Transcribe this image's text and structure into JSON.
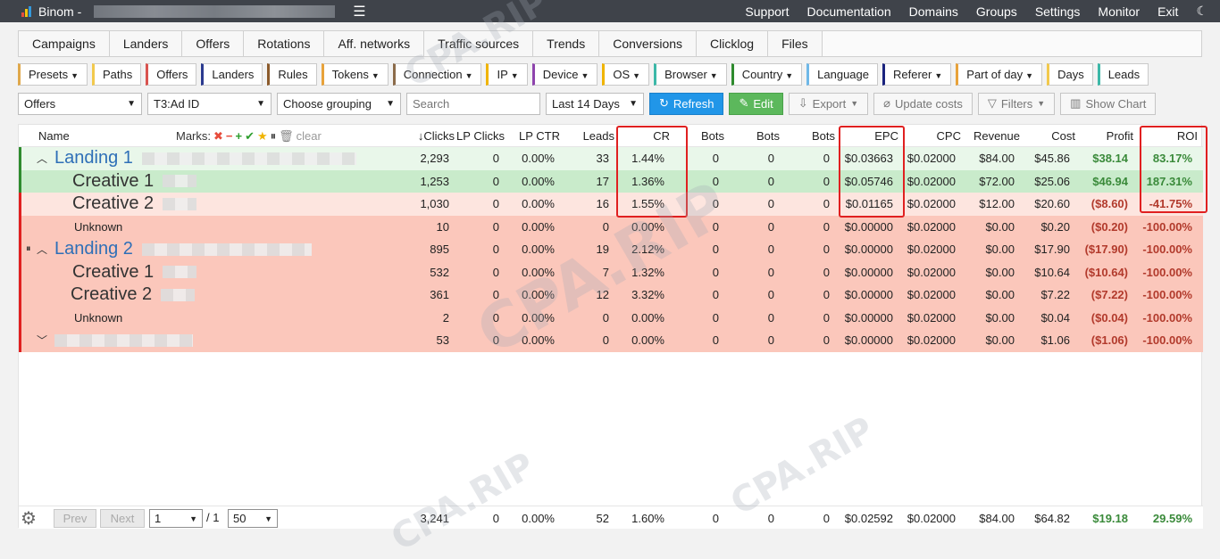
{
  "app": {
    "title": "Binom -",
    "nav": [
      "Support",
      "Documentation",
      "Domains",
      "Groups",
      "Settings",
      "Monitor",
      "Exit"
    ]
  },
  "tabs": [
    "Campaigns",
    "Landers",
    "Offers",
    "Rotations",
    "Aff. networks",
    "Traffic sources",
    "Trends",
    "Conversions",
    "Clicklog",
    "Files"
  ],
  "chips": [
    {
      "label": "Presets",
      "caret": true,
      "color": "#e0a84a"
    },
    {
      "label": "Paths",
      "caret": false,
      "color": "#f2c94c"
    },
    {
      "label": "Offers",
      "caret": false,
      "color": "#d9534f"
    },
    {
      "label": "Landers",
      "caret": false,
      "color": "#2b3a8f"
    },
    {
      "label": "Rules",
      "caret": false,
      "color": "#8b5a2b"
    },
    {
      "label": "Tokens",
      "caret": true,
      "color": "#e8a23a"
    },
    {
      "label": "Connection",
      "caret": true,
      "color": "#8b6b4a"
    },
    {
      "label": "IP",
      "caret": true,
      "color": "#f0b400"
    },
    {
      "label": "Device",
      "caret": true,
      "color": "#8e44ad"
    },
    {
      "label": "OS",
      "caret": true,
      "color": "#f0b400"
    },
    {
      "label": "Browser",
      "caret": true,
      "color": "#3cb8a8"
    },
    {
      "label": "Country",
      "caret": true,
      "color": "#2e8b2e"
    },
    {
      "label": "Language",
      "caret": false,
      "color": "#6fb8e8"
    },
    {
      "label": "Referer",
      "caret": true,
      "color": "#1a237e"
    },
    {
      "label": "Part of day",
      "caret": true,
      "color": "#e8a23a"
    },
    {
      "label": "Days",
      "caret": false,
      "color": "#f2c94c"
    },
    {
      "label": "Leads",
      "caret": false,
      "color": "#3cb8a8"
    }
  ],
  "toolbar": {
    "group1": "Offers",
    "group2": "T3:Ad ID",
    "group3": "Choose grouping",
    "search_placeholder": "Search",
    "period": "Last 14 Days",
    "refresh": "Refresh",
    "edit": "Edit",
    "export": "Export",
    "update_costs": "Update costs",
    "filters": "Filters",
    "show_chart": "Show Chart"
  },
  "columns": {
    "name": "Name",
    "marks": "Marks:",
    "clear": "clear",
    "clicks": "Clicks",
    "lp_clicks": "LP Clicks",
    "lp_ctr": "LP CTR",
    "leads": "Leads",
    "cr": "CR",
    "bots1": "Bots",
    "bots2": "Bots",
    "bots3": "Bots",
    "epc": "EPC",
    "cpc": "CPC",
    "revenue": "Revenue",
    "cost": "Cost",
    "profit": "Profit",
    "roi": "ROI"
  },
  "rows": [
    {
      "name": "Landing 1",
      "clicks": "2,293",
      "lp_clicks": "0",
      "lp_ctr": "0.00%",
      "leads": "33",
      "cr": "1.44%",
      "b1": "0",
      "b2": "0",
      "b3": "0",
      "epc": "$0.03663",
      "cpc": "$0.02000",
      "revenue": "$84.00",
      "cost": "$45.86",
      "profit": "$38.14",
      "roi": "83.17%"
    },
    {
      "name": "Creative 1",
      "clicks": "1,253",
      "lp_clicks": "0",
      "lp_ctr": "0.00%",
      "leads": "17",
      "cr": "1.36%",
      "b1": "0",
      "b2": "0",
      "b3": "0",
      "epc": "$0.05746",
      "cpc": "$0.02000",
      "revenue": "$72.00",
      "cost": "$25.06",
      "profit": "$46.94",
      "roi": "187.31%"
    },
    {
      "name": "Creative 2",
      "clicks": "1,030",
      "lp_clicks": "0",
      "lp_ctr": "0.00%",
      "leads": "16",
      "cr": "1.55%",
      "b1": "0",
      "b2": "0",
      "b3": "0",
      "epc": "$0.01165",
      "cpc": "$0.02000",
      "revenue": "$12.00",
      "cost": "$20.60",
      "profit": "($8.60)",
      "roi": "-41.75%"
    },
    {
      "name": "Unknown",
      "clicks": "10",
      "lp_clicks": "0",
      "lp_ctr": "0.00%",
      "leads": "0",
      "cr": "0.00%",
      "b1": "0",
      "b2": "0",
      "b3": "0",
      "epc": "$0.00000",
      "cpc": "$0.02000",
      "revenue": "$0.00",
      "cost": "$0.20",
      "profit": "($0.20)",
      "roi": "-100.00%"
    },
    {
      "name": "Landing 2",
      "clicks": "895",
      "lp_clicks": "0",
      "lp_ctr": "0.00%",
      "leads": "19",
      "cr": "2.12%",
      "b1": "0",
      "b2": "0",
      "b3": "0",
      "epc": "$0.00000",
      "cpc": "$0.02000",
      "revenue": "$0.00",
      "cost": "$17.90",
      "profit": "($17.90)",
      "roi": "-100.00%"
    },
    {
      "name": "Creative 1",
      "clicks": "532",
      "lp_clicks": "0",
      "lp_ctr": "0.00%",
      "leads": "7",
      "cr": "1.32%",
      "b1": "0",
      "b2": "0",
      "b3": "0",
      "epc": "$0.00000",
      "cpc": "$0.02000",
      "revenue": "$0.00",
      "cost": "$10.64",
      "profit": "($10.64)",
      "roi": "-100.00%"
    },
    {
      "name": "Creative 2",
      "clicks": "361",
      "lp_clicks": "0",
      "lp_ctr": "0.00%",
      "leads": "12",
      "cr": "3.32%",
      "b1": "0",
      "b2": "0",
      "b3": "0",
      "epc": "$0.00000",
      "cpc": "$0.02000",
      "revenue": "$0.00",
      "cost": "$7.22",
      "profit": "($7.22)",
      "roi": "-100.00%"
    },
    {
      "name": "Unknown",
      "clicks": "2",
      "lp_clicks": "0",
      "lp_ctr": "0.00%",
      "leads": "0",
      "cr": "0.00%",
      "b1": "0",
      "b2": "0",
      "b3": "0",
      "epc": "$0.00000",
      "cpc": "$0.02000",
      "revenue": "$0.00",
      "cost": "$0.04",
      "profit": "($0.04)",
      "roi": "-100.00%"
    },
    {
      "name": "",
      "clicks": "53",
      "lp_clicks": "0",
      "lp_ctr": "0.00%",
      "leads": "0",
      "cr": "0.00%",
      "b1": "0",
      "b2": "0",
      "b3": "0",
      "epc": "$0.00000",
      "cpc": "$0.02000",
      "revenue": "$0.00",
      "cost": "$1.06",
      "profit": "($1.06)",
      "roi": "-100.00%"
    }
  ],
  "totals": {
    "clicks": "3,241",
    "lp_clicks": "0",
    "lp_ctr": "0.00%",
    "leads": "52",
    "cr": "1.60%",
    "b1": "0",
    "b2": "0",
    "b3": "0",
    "epc": "$0.02592",
    "cpc": "$0.02000",
    "revenue": "$84.00",
    "cost": "$64.82",
    "profit": "$19.18",
    "roi": "29.59%"
  },
  "footer": {
    "prev": "Prev",
    "next": "Next",
    "page": "1",
    "of": "/ 1",
    "per_page": "50"
  },
  "watermark": "CPA.RIP"
}
